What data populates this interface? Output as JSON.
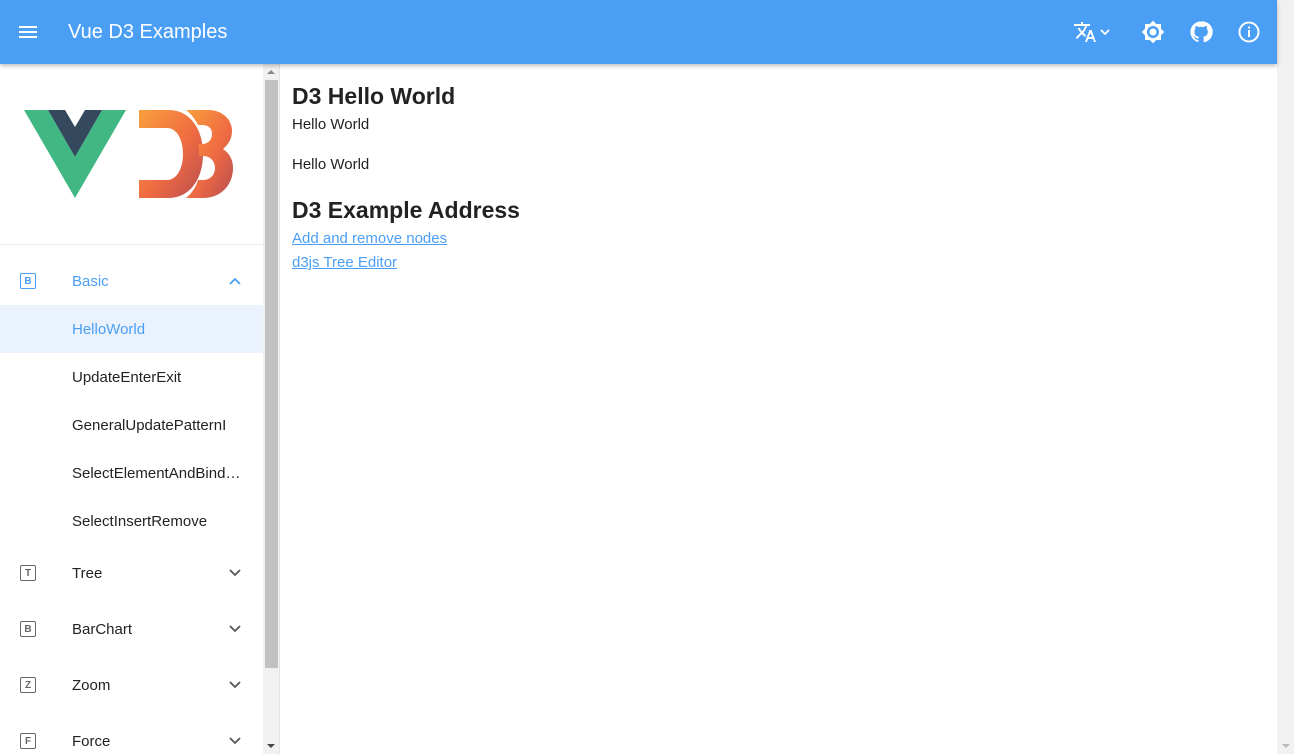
{
  "app": {
    "title": "Vue D3 Examples"
  },
  "icons": {
    "menu": "menu-icon",
    "translate": "translate-icon",
    "theme": "brightness-icon",
    "github": "github-icon",
    "info": "info-icon"
  },
  "colors": {
    "primary": "#4a9ff5",
    "active_bg": "#e9f2fd"
  },
  "sidebar": {
    "groups": [
      {
        "letter": "B",
        "label": "Basic",
        "open": true,
        "items": [
          {
            "label": "HelloWorld",
            "active": true
          },
          {
            "label": "UpdateEnterExit"
          },
          {
            "label": "GeneralUpdatePatternI"
          },
          {
            "label": "SelectElementAndBindData"
          },
          {
            "label": "SelectInsertRemove"
          }
        ]
      },
      {
        "letter": "T",
        "label": "Tree"
      },
      {
        "letter": "B",
        "label": "BarChart"
      },
      {
        "letter": "Z",
        "label": "Zoom"
      },
      {
        "letter": "F",
        "label": "Force"
      }
    ]
  },
  "main": {
    "title": "D3 Hello World",
    "lines": [
      "Hello World",
      "Hello World"
    ],
    "address_title": "D3 Example Address",
    "links": [
      "Add and remove nodes",
      "d3js Tree Editor"
    ]
  }
}
